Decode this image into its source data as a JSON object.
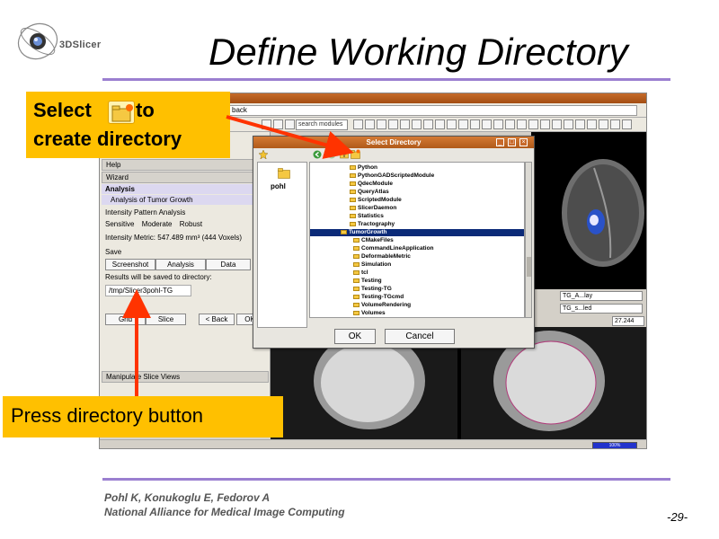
{
  "slide": {
    "logo_text": "3DSlicer",
    "title": "Define Working Directory",
    "footer_line1": "Pohl K, Konukoglu E, Fedorov A",
    "footer_line2": "National Alliance for Medical Image Computing",
    "page_number": "-29-"
  },
  "callouts": {
    "select_word": "Select",
    "to_word": "to",
    "create_line": "create directory",
    "press_line": "Press directory button",
    "color": "#ffc000",
    "arrow_color": "#ff3300"
  },
  "app": {
    "nav_text": "back",
    "search_placeholder": "search modules",
    "left_panel": {
      "help_label": "Help",
      "wizard_label": "Wizard",
      "analysis_label": "Analysis",
      "analysis_item": "Analysis of Tumor Growth",
      "intensity_label": "Intensity Pattern Analysis",
      "radio_options": [
        "Sensitive",
        "Moderate",
        "Robust"
      ],
      "intensity_metric": "Intensity Metric: 547.489 mm³ (444 Voxels)",
      "save_label": "Save",
      "save_tabs": [
        "Screenshot",
        "Analysis",
        "Data"
      ],
      "results_text": "Results will be saved to directory:",
      "directory_value": "/tmp/Slicer3pohl-TG",
      "nav_buttons": [
        "Grid",
        "Slice",
        "< Back",
        "OK"
      ],
      "manipulate_label": "Manipulate Slice Views"
    },
    "viewer_controls": {
      "field1": "TG_A...lay",
      "field2": "TG_s...led",
      "value": "27.244"
    },
    "status_progress": "100%"
  },
  "dialog": {
    "title": "Select Directory",
    "left_item": "pohl",
    "tree": [
      {
        "label": "Python",
        "selected": false
      },
      {
        "label": "PythonGADScriptedModule",
        "selected": false
      },
      {
        "label": "QdecModule",
        "selected": false
      },
      {
        "label": "QueryAtlas",
        "selected": false
      },
      {
        "label": "ScriptedModule",
        "selected": false
      },
      {
        "label": "SlicerDaemon",
        "selected": false
      },
      {
        "label": "Statistics",
        "selected": false
      },
      {
        "label": "Tractography",
        "selected": false
      },
      {
        "label": "TumorGrowth",
        "selected": true
      },
      {
        "label": "CMakeFiles",
        "selected": false
      },
      {
        "label": "CommandLineApplication",
        "selected": false
      },
      {
        "label": "DeformableMetric",
        "selected": false
      },
      {
        "label": "Simulation",
        "selected": false
      },
      {
        "label": "tcl",
        "selected": false
      },
      {
        "label": "Testing",
        "selected": false
      },
      {
        "label": "Testing-TG",
        "selected": false
      },
      {
        "label": "Testing-TGcmd",
        "selected": false
      },
      {
        "label": "VolumeRendering",
        "selected": false
      },
      {
        "label": "Volumes",
        "selected": false
      }
    ],
    "ok_label": "OK",
    "cancel_label": "Cancel"
  }
}
